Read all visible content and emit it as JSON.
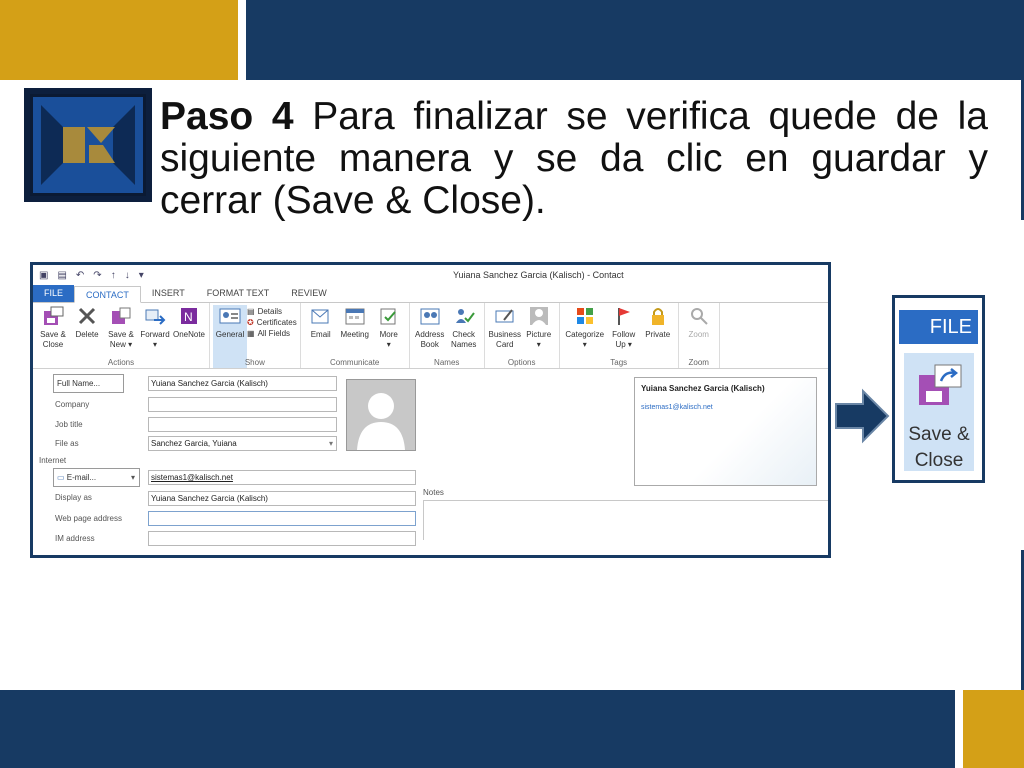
{
  "slide": {
    "heading_bold": "Paso 4",
    "heading_text": " Para finalizar se verifica quede de la siguiente manera y se da clic en guardar y cerrar (Save & Close)."
  },
  "window": {
    "title": "Yuiana Sanchez Garcia (Kalisch) - Contact",
    "tabs": [
      "FILE",
      "CONTACT",
      "INSERT",
      "FORMAT TEXT",
      "REVIEW"
    ],
    "active_tab": "CONTACT"
  },
  "ribbon": {
    "actions": {
      "label": "Actions",
      "save_close": [
        "Save &",
        "Close"
      ],
      "delete": [
        "Delete"
      ],
      "save_new": [
        "Save &",
        "New ▾"
      ],
      "forward": [
        "Forward",
        "▾"
      ],
      "onenote": [
        "OneNote"
      ]
    },
    "show": {
      "label": "Show",
      "general": "General",
      "details": "Details",
      "certificates": "Certificates",
      "all_fields": "All Fields"
    },
    "communicate": {
      "label": "Communicate",
      "email": "Email",
      "meeting": "Meeting",
      "more": [
        "More",
        "▾"
      ]
    },
    "names": {
      "label": "Names",
      "address_book": [
        "Address",
        "Book"
      ],
      "check_names": [
        "Check",
        "Names"
      ]
    },
    "options": {
      "label": "Options",
      "business_card": [
        "Business",
        "Card"
      ],
      "picture": [
        "Picture",
        "▾"
      ]
    },
    "tags": {
      "label": "Tags",
      "categorize": [
        "Categorize",
        "▾"
      ],
      "follow_up": [
        "Follow",
        "Up ▾"
      ],
      "private": "Private"
    },
    "zoom": {
      "label": "Zoom",
      "zoom": "Zoom"
    }
  },
  "form": {
    "full_name_btn": "Full Name...",
    "full_name": "Yuiana Sanchez Garcia (Kalisch)",
    "company_lbl": "Company",
    "company": "",
    "job_title_lbl": "Job title",
    "job_title": "",
    "file_as_lbl": "File as",
    "file_as": "Sanchez Garcia, Yuiana",
    "internet_lbl": "Internet",
    "email_btn": "E-mail...",
    "email": "sistemas1@kalisch.net",
    "display_as_lbl": "Display as",
    "display_as": "Yuiana Sanchez Garcia (Kalisch)",
    "web_lbl": "Web page address",
    "web": "",
    "im_lbl": "IM address",
    "im": "",
    "notes_lbl": "Notes"
  },
  "card": {
    "name": "Yuiana Sanchez Garcia (Kalisch)",
    "email": "sistemas1@kalisch.net"
  },
  "zoom_panel": {
    "file": "FILE",
    "save_close": [
      "Save &",
      "Close"
    ]
  },
  "colors": {
    "navy": "#173a63",
    "gold": "#d4a017",
    "office_blue": "#2b6cc4"
  }
}
